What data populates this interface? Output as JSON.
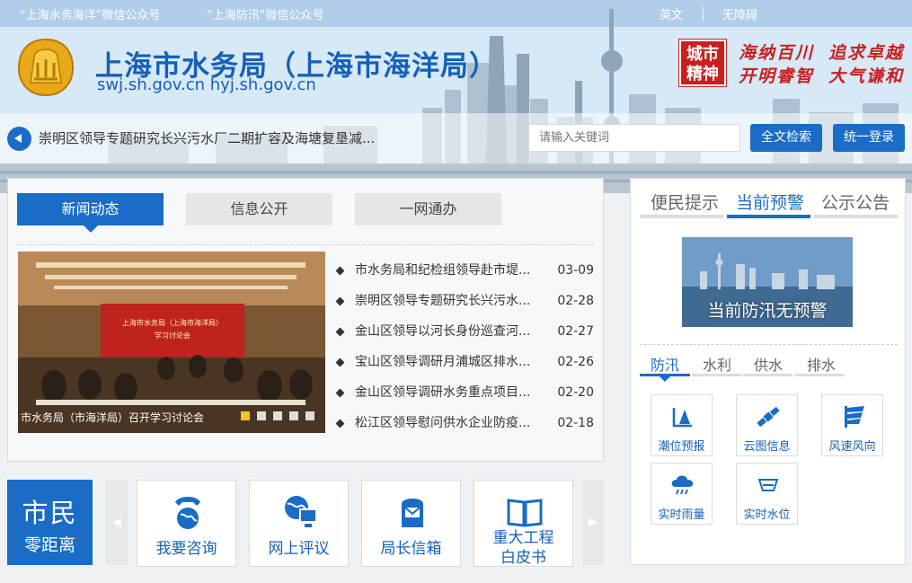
{
  "header": {
    "wechat_links": [
      "“上海水务海洋”微信公众号",
      "“上海防汛”微信公众号"
    ],
    "lang_link": "英文",
    "accessibility_link": "无障碍",
    "site_title": "上海市水务局（上海市海洋局）",
    "domains": "swj.sh.gov.cn  hyj.sh.gov.cn",
    "city_seal": [
      "城市",
      "精神"
    ],
    "slogans": [
      "海纳百川",
      "追求卓越",
      "开明睿智",
      "大气谦和"
    ]
  },
  "searchbar": {
    "ticker_text": "崇明区领导专题研究长兴污水厂二期扩容及海塘复垦减...",
    "placeholder": "请输入关键词",
    "search_button": "全文检索",
    "login_button": "统一登录"
  },
  "news": {
    "tabs": [
      "新闻动态",
      "信息公开",
      "一网通办"
    ],
    "photo_caption": "市水务局（市海洋局）召开学习讨论会",
    "photo_banner": [
      "上海市水务局（上海市海洋局）",
      "学习讨论会"
    ],
    "slide_count": 5,
    "active_slide": 1,
    "items": [
      {
        "title": "市水务局和纪检组领导赴市堤...",
        "date": "03-09"
      },
      {
        "title": "崇明区领导专题研究长兴污水...",
        "date": "02-28"
      },
      {
        "title": "金山区领导以河长身份巡查河...",
        "date": "02-27"
      },
      {
        "title": "宝山区领导调研月浦城区排水...",
        "date": "02-26"
      },
      {
        "title": "金山区领导调研水务重点项目...",
        "date": "02-20"
      },
      {
        "title": "松江区领导慰问供水企业防疫...",
        "date": "02-18"
      }
    ]
  },
  "citizen": {
    "title": "市民",
    "subtitle": "零距离",
    "prev_arrow": "◀",
    "next_arrow": "▶",
    "services": [
      {
        "label": "我要咨询",
        "icon": "phone-globe-icon"
      },
      {
        "label": "网上评议",
        "icon": "computer-globe-icon"
      },
      {
        "label": "局长信箱",
        "icon": "mailbox-icon"
      },
      {
        "label": "重大工程",
        "label2": "白皮书",
        "icon": "book-icon"
      }
    ]
  },
  "right_panel": {
    "tabs": [
      "便民提示",
      "当前预警",
      "公示公告"
    ],
    "active_tab": 1,
    "warning_text": "当前防汛无预警",
    "sub_tabs": [
      "防汛",
      "水利",
      "供水",
      "排水"
    ],
    "active_sub_tab": 0,
    "tiles": [
      {
        "label": "潮位预报",
        "icon": "tide-icon"
      },
      {
        "label": "云图信息",
        "icon": "satellite-icon"
      },
      {
        "label": "风速风向",
        "icon": "wind-flag-icon"
      },
      {
        "label": "实时雨量",
        "icon": "rain-cloud-icon"
      },
      {
        "label": "实时水位",
        "icon": "water-level-icon"
      }
    ]
  },
  "colors": {
    "primary": "#1a6cc6",
    "title_blue": "#1560b8",
    "slogan_red": "#c9201f",
    "active_dot": "#f3c51b"
  }
}
